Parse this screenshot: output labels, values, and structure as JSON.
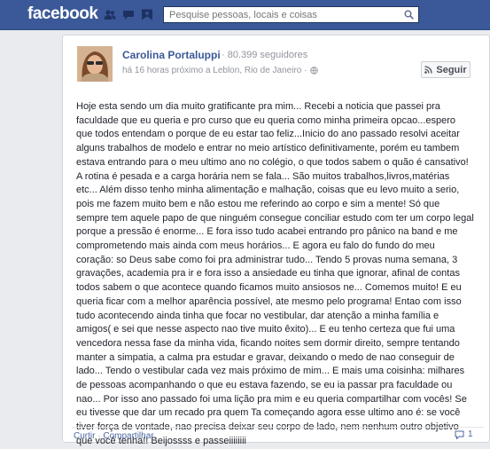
{
  "topbar": {
    "logo": "facebook",
    "jewels": [
      "friends-icon",
      "messages-icon",
      "notifications-icon"
    ],
    "search": {
      "placeholder": "Pesquise pessoas, locais e coisas"
    }
  },
  "post": {
    "author": "Carolina Portaluppi",
    "followers": "· 80.399 seguidores",
    "meta": "há 16 horas próximo a Leblon, Rio de Janeiro ·",
    "follow_label": "Seguir",
    "text": "Hoje esta sendo um dia muito gratificante pra mim... Recebi a noticia que passei pra\nfaculdade que eu queria e pro curso que eu queria como minha primeira opcao...espero\nque todos entendam o porque de eu estar tao feliz...Inicio do ano passado resolvi aceitar\nalguns trabalhos de modelo e entrar no meio artístico definitivamente, porém eu tambem\nestava entrando para o meu ultimo ano no colégio, o que todos sabem o quão é cansativo!\nA rotina é pesada e a carga horária nem se fala... São muitos trabalhos,livros,matérias\netc... Além disso tenho minha alimentação e malhação, coisas que eu levo muito a serio,\npois me fazem muito bem e não estou me referindo ao corpo e sim a mente! Só que\nsempre tem aquele papo de que ninguém consegue conciliar estudo com ter um corpo legal\nporque a pressão é enorme... E fora isso tudo acabei entrando pro pânico na band e me\ncomprometendo mais ainda com meus horários... E agora eu falo do fundo do meu\ncoração: so Deus sabe como foi pra administrar tudo... Tendo 5 provas numa semana, 3\ngravações, academia pra ir e fora isso a ansiedade eu tinha que ignorar, afinal de contas\ntodos sabem o que acontece quando ficamos muito ansiosos ne... Comemos muito! E eu\nqueria ficar com a melhor aparência possível, ate mesmo pelo programa! Entao com isso\ntudo acontecendo ainda tinha que focar no vestibular, dar atenção a minha família e\namigos( e sei que nesse aspecto nao tive muito êxito)... E eu tenho certeza que fui uma\nvencedora nessa fase da minha vida, ficando noites sem dormir direito, sempre tentando\nmanter a simpatia, a calma pra estudar e gravar, deixando o medo de nao conseguir de\nlado... Tendo o vestibular cada vez mais próximo de mim... E mais uma coisinha: milhares\nde pessoas acompanhando o que eu estava fazendo, se eu ia passar pra faculdade ou\nnao... Por isso ano passado foi uma lição pra mim e eu queria compartilhar com vocês! Se\neu tivesse que dar um recado pra quem Ta começando agora esse ultimo ano é: se você\ntiver força de vontade, nao precisa deixar seu corpo de lado, nem nenhum outro objetivo\nque você tenha!! Beijossss e passeiiiiiiii",
    "actions": {
      "like": "Curtir",
      "separator": " · ",
      "share": "Compartilhar"
    },
    "comment_count": "1"
  }
}
